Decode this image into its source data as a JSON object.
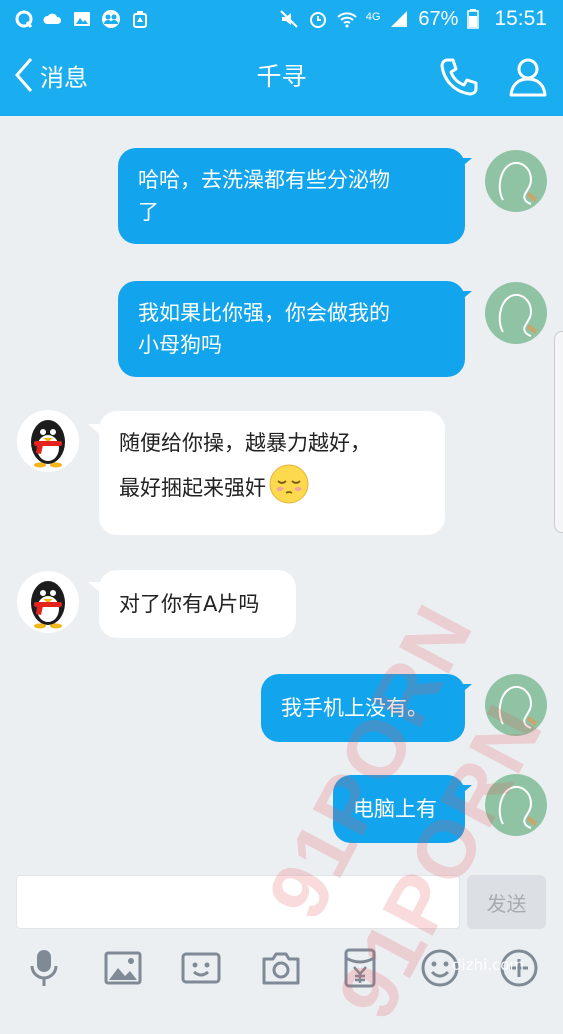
{
  "status_bar": {
    "battery_percent": "67%",
    "network": "4G",
    "time": "15:51",
    "left_icons": [
      "qq-icon",
      "cloud-icon",
      "image-icon",
      "contacts-icon",
      "cleaner-icon"
    ],
    "right_icons": [
      "mute-icon",
      "alarm-icon",
      "wifi-icon",
      "signal-icon",
      "battery-icon"
    ]
  },
  "nav": {
    "back_label": "消息",
    "title": "千寻"
  },
  "messages": [
    {
      "side": "out",
      "text": [
        "哈哈，去洗澡都有些分泌物",
        "了"
      ]
    },
    {
      "side": "out",
      "text": [
        "我如果比你强，你会做我的",
        "小母狗吗"
      ]
    },
    {
      "side": "in",
      "text": [
        "随便给你操，越暴力越好，",
        "最好捆起来强奸"
      ],
      "emoji": "sleepy-face-emoji"
    },
    {
      "side": "in",
      "text": [
        "对了你有A片吗"
      ]
    },
    {
      "side": "out",
      "text": [
        "我手机上没有。"
      ]
    },
    {
      "side": "out",
      "text": [
        "电脑上有"
      ]
    }
  ],
  "input": {
    "value": "",
    "send_label": "发送"
  },
  "toolbar": [
    "microphone-icon",
    "image-icon",
    "video-call-icon",
    "camera-icon",
    "red-packet-icon",
    "emoji-icon",
    "plus-icon"
  ],
  "watermark": {
    "text1": "91PORN",
    "text2": "91PORN",
    "site": "dizhi.com"
  },
  "colors": {
    "brand": "#1aaef0",
    "outgoing_bubble": "#12a4ed",
    "incoming_bubble": "#ffffff",
    "background": "#eceff2"
  }
}
